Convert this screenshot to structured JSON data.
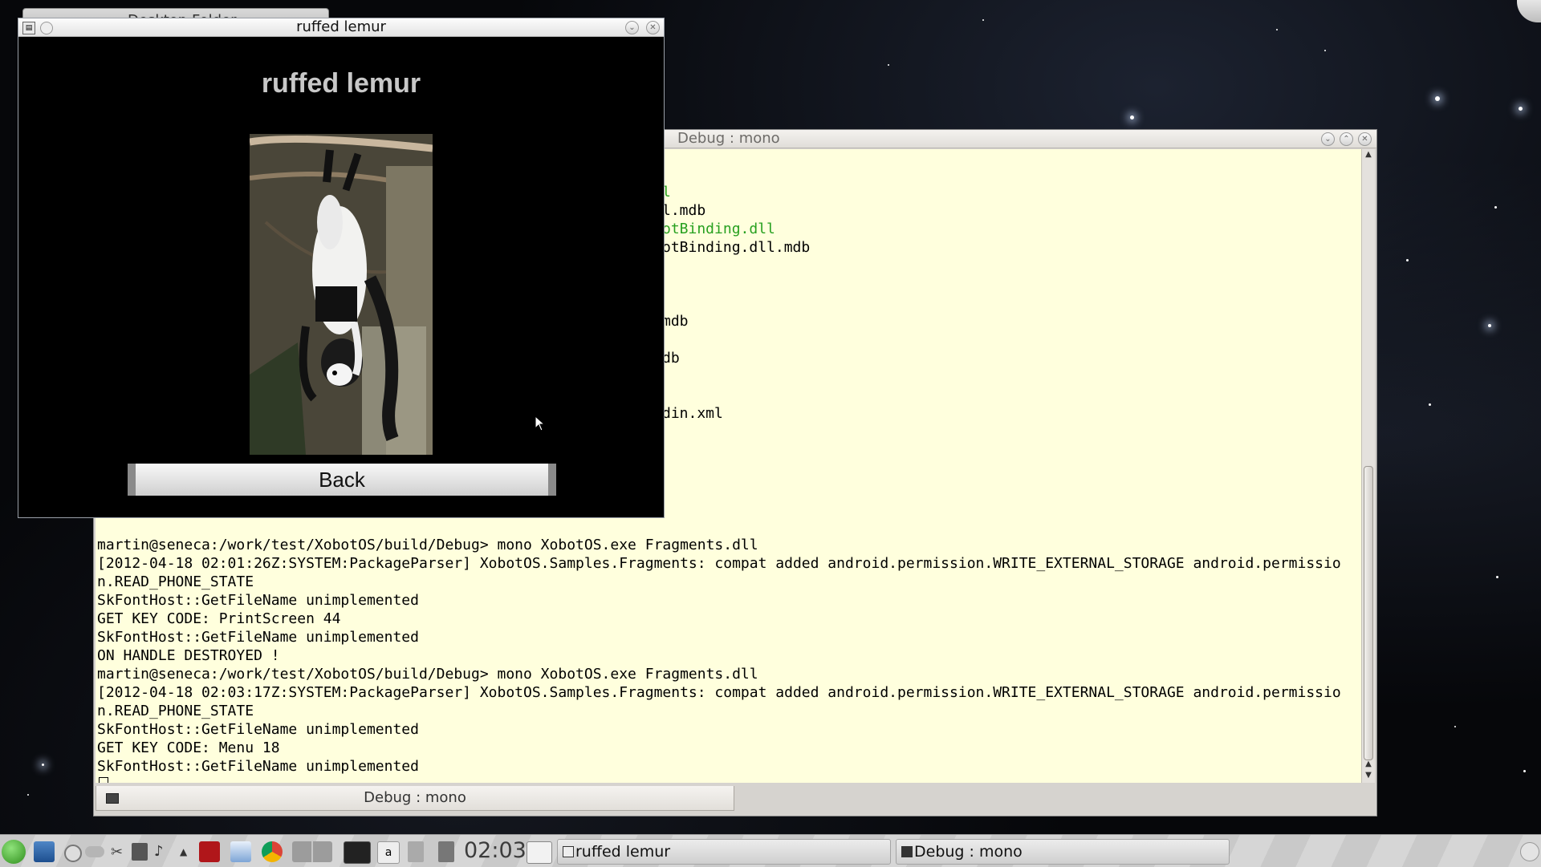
{
  "desktop": {
    "background_folder_title": "Desktop Folder"
  },
  "app_window": {
    "title": "ruffed lemur",
    "heading": "ruffed lemur",
    "image_description": "ruffed lemur photo",
    "back_label": "Back"
  },
  "terminal": {
    "title": "Debug : mono",
    "tab_label": "Debug : mono",
    "partial_lines": [
      {
        "text": "l",
        "color": "green"
      },
      {
        "text": "l.mdb",
        "color": "default"
      },
      {
        "text": "otBinding.dll",
        "color": "green"
      },
      {
        "text": "otBinding.dll.mdb",
        "color": "default"
      },
      {
        "text": "mdb",
        "color": "default"
      },
      {
        "text": "db",
        "color": "default"
      },
      {
        "text": "din.xml",
        "color": "default"
      }
    ],
    "lines": [
      "martin@seneca:/work/test/XobotOS/build/Debug> mono XobotOS.exe Fragments.dll",
      "[2012-04-18 02:01:26Z:SYSTEM:PackageParser] XobotOS.Samples.Fragments: compat added android.permission.WRITE_EXTERNAL_STORAGE android.permissio",
      "n.READ_PHONE_STATE",
      "SkFontHost::GetFileName unimplemented",
      "GET KEY CODE: PrintScreen 44",
      "SkFontHost::GetFileName unimplemented",
      "ON HANDLE DESTROYED !",
      "martin@seneca:/work/test/XobotOS/build/Debug> mono XobotOS.exe Fragments.dll",
      "[2012-04-18 02:03:17Z:SYSTEM:PackageParser] XobotOS.Samples.Fragments: compat added android.permission.WRITE_EXTERNAL_STORAGE android.permissio",
      "n.READ_PHONE_STATE",
      "SkFontHost::GetFileName unimplemented",
      "GET KEY CODE: Menu 18",
      "SkFontHost::GetFileName unimplemented"
    ]
  },
  "taskbar": {
    "clock": "02:03",
    "tasks": [
      "ruffed lemur",
      "Debug : mono"
    ],
    "launcher_icons": [
      "kde-menu-icon",
      "desktop-icon",
      "info-icon",
      "weather-icon",
      "scissors-icon",
      "device-icon",
      "volume-icon",
      "arrow-up-icon",
      "dictionary-icon",
      "notes-icon",
      "chrome-icon",
      "pager-icon",
      "terminal-icon",
      "text-icon",
      "trash-icon",
      "calculator-icon",
      "windows-icon"
    ]
  },
  "colors": {
    "terminal_bg": "#ffffdd",
    "terminal_green": "#27a01f",
    "app_bg": "#000000",
    "heading_gray": "#c8c8c8"
  }
}
